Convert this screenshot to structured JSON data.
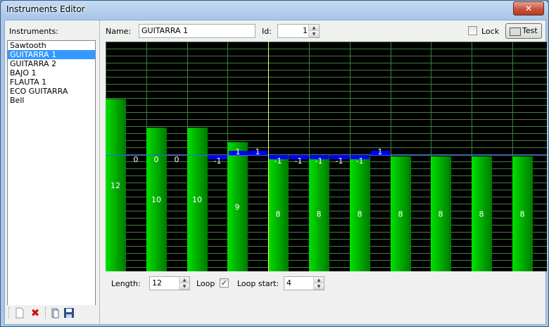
{
  "window": {
    "title": "Instruments Editor",
    "close_glyph": "✕"
  },
  "instruments": {
    "label": "Instruments:",
    "items": [
      "Sawtooth",
      "GUITARRA 1",
      "GUITARRA 2",
      "BAJO 1",
      "FLAUTA 1",
      "ECO GUITARRA",
      "Bell"
    ],
    "selected_index": 1
  },
  "toolbar": {
    "icons": [
      "new-icon",
      "delete-icon",
      "open-icon",
      "save-icon"
    ],
    "delete_glyph": "✖"
  },
  "editor": {
    "name_label": "Name:",
    "name_value": "GUITARRA 1",
    "id_label": "Id:",
    "id_value": "1",
    "lock_label": "Lock",
    "lock_checked": false,
    "test_label": "Test",
    "length_label": "Length:",
    "length_value": "12",
    "loop_label": "Loop",
    "loop_checked": true,
    "check_glyph": "✓",
    "loop_start_label": "Loop start:",
    "loop_start_value": "4"
  },
  "chart_data": {
    "type": "bar",
    "values": [
      12,
      10,
      10,
      9,
      8,
      8,
      8,
      8,
      8,
      8,
      8
    ],
    "offsets": [
      0,
      0,
      0,
      null,
      -1,
      1,
      1,
      -1,
      -1,
      -1,
      -1,
      -1,
      1
    ],
    "bar_labels": [
      "12",
      "10",
      "10",
      "9",
      "8",
      "8",
      "8",
      "8",
      "8",
      "8",
      "8"
    ],
    "offset_labels": [
      "0",
      "0",
      "0",
      "",
      "-1",
      "1",
      "1",
      "-1",
      "-1",
      "-1",
      "-1",
      "-1",
      "1"
    ],
    "ylim": [
      0,
      16
    ],
    "colors": {
      "bar": "#00e000",
      "bar_dark": "#007a00",
      "offset": "#0000ff",
      "grid": "#3f7f3f",
      "cursor": "#ffff66",
      "baseline": "#3060ff"
    }
  }
}
